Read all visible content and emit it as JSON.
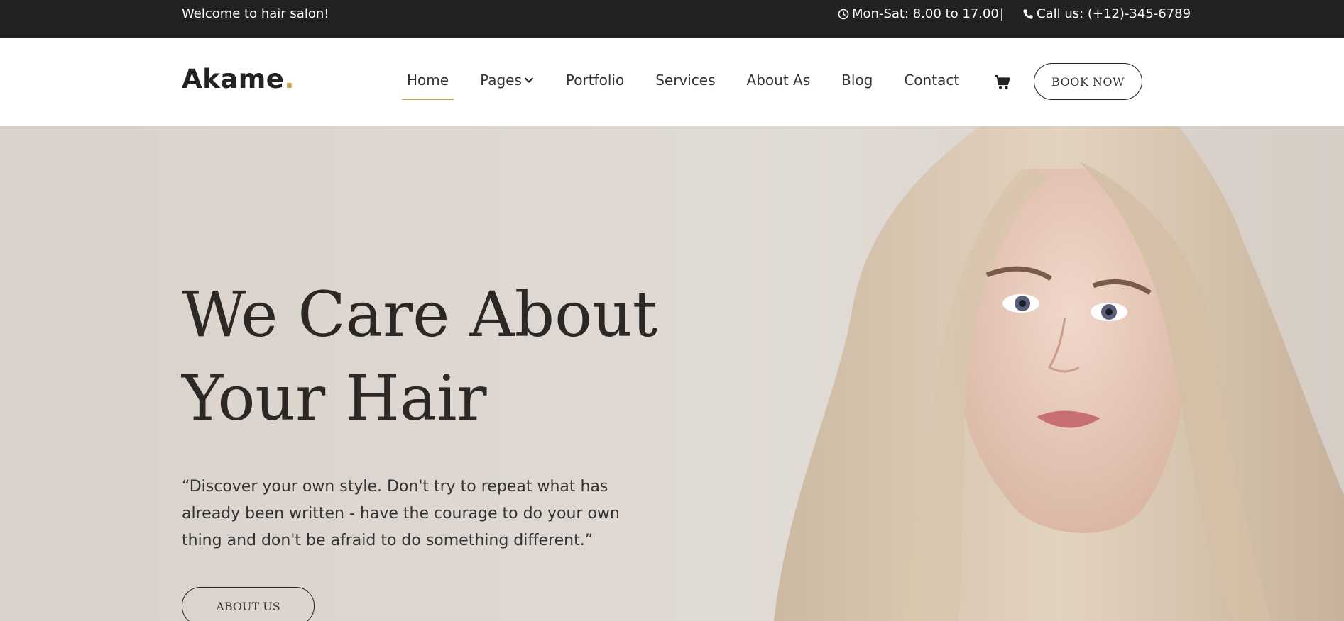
{
  "topbar": {
    "welcome": "Welcome to hair salon!",
    "hours": "Mon-Sat: 8.00 to 17.00",
    "separator": "|",
    "phone": "Call us: (+12)-345-6789",
    "icons": {
      "hours": "clock-icon",
      "phone": "phone-icon"
    }
  },
  "nav": {
    "logo": "Akame",
    "logo_dot": ".",
    "items": [
      {
        "label": "Home",
        "active": true
      },
      {
        "label": "Pages",
        "has_dropdown": true
      },
      {
        "label": "Portfolio"
      },
      {
        "label": "Services"
      },
      {
        "label": "About As"
      },
      {
        "label": "Blog"
      },
      {
        "label": "Contact"
      }
    ],
    "cart_icon": "cart-icon",
    "book_now": "BOOK NOW"
  },
  "hero": {
    "title_line1": "We Care About",
    "title_line2": "Your Hair",
    "quote": "“Discover your own style. Don't try to repeat what has already been written - have the courage to do your own thing and don't be afraid to do something different.”",
    "about_button": "ABOUT US"
  },
  "colors": {
    "topbar_bg": "#222222",
    "accent": "#c2a25a",
    "hero_bg": "#ddd6cf"
  }
}
